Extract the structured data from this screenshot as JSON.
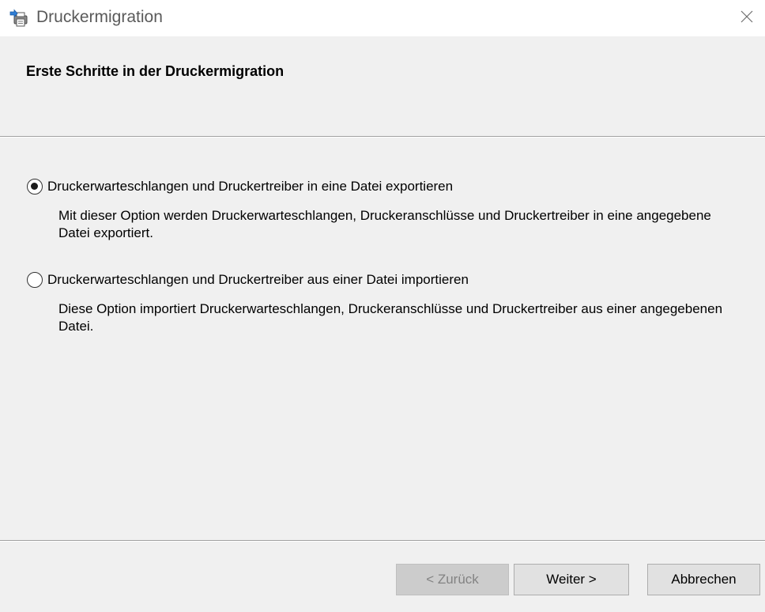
{
  "window": {
    "title": "Druckermigration",
    "app_icon": "printer-migration-icon",
    "close_icon": "close-icon"
  },
  "header": {
    "title": "Erste Schritte in der Druckermigration"
  },
  "options": [
    {
      "label": "Druckerwarteschlangen und Druckertreiber in eine Datei exportieren",
      "description": "Mit dieser Option werden Druckerwarteschlangen, Druckeranschlüsse und Druckertreiber in eine angegebene Datei exportiert.",
      "selected": true
    },
    {
      "label": "Druckerwarteschlangen und Druckertreiber aus einer Datei importieren",
      "description": "Diese Option importiert Druckerwarteschlangen, Druckeranschlüsse und Druckertreiber aus einer angegebenen Datei.",
      "selected": false
    }
  ],
  "buttons": {
    "back": {
      "label": "< Zurück",
      "enabled": false
    },
    "next": {
      "label": "Weiter >",
      "enabled": true
    },
    "cancel": {
      "label": "Abbrechen",
      "enabled": true
    }
  },
  "colors": {
    "dialog_background": "#f0f0f0",
    "titlebar_background": "#ffffff",
    "disabled_text": "#838383"
  }
}
